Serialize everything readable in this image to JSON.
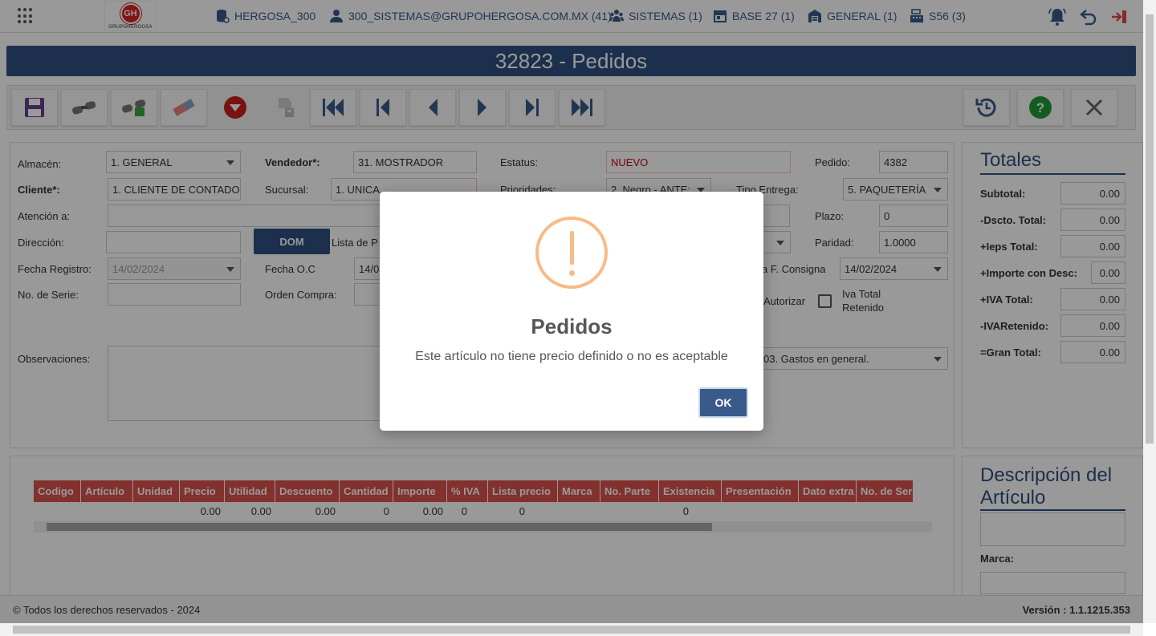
{
  "header": {
    "database": "HERGOSA_300",
    "user": "300_SISTEMAS@GRUPOHERGOSA.COM.MX (41)",
    "department": "SISTEMAS (1)",
    "base": "BASE 27 (1)",
    "warehouse": "GENERAL (1)",
    "terminal": "S56 (3)",
    "logo_initials": "GH",
    "logo_text": "GRUPOHERGOSA"
  },
  "page_title": "32823 - Pedidos",
  "toolbar": {
    "icons": [
      "save-icon",
      "binoculars-icon",
      "binoculars-green-icon",
      "eraser-icon",
      "down-circle-icon",
      "document-icon",
      "first-icon",
      "prev-page-icon",
      "prev-icon",
      "next-icon",
      "next-page-icon",
      "last-icon",
      "history-icon",
      "help-icon",
      "close-icon"
    ]
  },
  "form": {
    "almacen_label": "Almacén:",
    "almacen_value": "1. GENERAL",
    "vendedor_label": "Vendedor*:",
    "vendedor_value": "31. MOSTRADOR",
    "estatus_label": "Estatus:",
    "estatus_value": "NUEVO",
    "pedido_label": "Pedido:",
    "pedido_value": "4382",
    "cliente_label": "Cliente*:",
    "cliente_value": "1. CLIENTE DE CONTADO",
    "sucursal_label": "Sucursal:",
    "sucursal_value": "1. UNICA",
    "prioridades_label": "Prioridades:",
    "prioridades_value": "2. Negro - ANTE:",
    "tipo_entrega_label": "Tipo Entrega:",
    "tipo_entrega_value": "5. PAQUETERÍA",
    "atencion_label": "Atención a:",
    "plazo_label": "Plazo:",
    "plazo_value": "0",
    "direccion_label": "Dirección:",
    "dom_button": "DOM",
    "lista_label": "Lista de P",
    "paridad_label": "Paridad:",
    "paridad_value": "1.0000",
    "fecha_registro_label": "Fecha Registro:",
    "fecha_registro_value": "14/02/2024",
    "fecha_oc_label": "Fecha O.C",
    "fecha_oc_value": "14/0",
    "f_consigna_label": "a F. Consigna",
    "f_consigna_value": "14/02/2024",
    "serie_label": "No. de Serie:",
    "orden_label": "Orden Compra:",
    "autorizar_label": "Autorizar",
    "iva_retenido_label_1": "Iva Total",
    "iva_retenido_label_2": "Retenido",
    "observaciones_label": "Observaciones:",
    "uso_cfdi_value": "03. Gastos en general."
  },
  "totales": {
    "title": "Totales",
    "rows": [
      {
        "label": "Subtotal:",
        "value": "0.00"
      },
      {
        "label": "-Dscto. Total:",
        "value": "0.00"
      },
      {
        "label": "+Ieps Total:",
        "value": "0.00"
      },
      {
        "label": "+Importe con Desc:",
        "value": "0.00"
      },
      {
        "label": "+IVA Total:",
        "value": "0.00"
      },
      {
        "label": "-IVARetenido:",
        "value": "0.00"
      },
      {
        "label": "=Gran Total:",
        "value": "0.00"
      }
    ]
  },
  "grid": {
    "columns": [
      "Codigo",
      "Artículo",
      "Unidad",
      "Precio",
      "Utilidad",
      "Descuento",
      "Cantidad",
      "Importe",
      "% IVA",
      "Lista precio",
      "Marca",
      "No. Parte",
      "Existencia",
      "Presentación",
      "Dato extra",
      "No. de Seri"
    ],
    "row": [
      "",
      "",
      "",
      "0.00",
      "0.00",
      "0.00",
      "0",
      "0.00",
      "0",
      "0",
      "",
      "",
      "0",
      "",
      "",
      ""
    ]
  },
  "descripcion": {
    "title": "Descripción del Artículo",
    "marca_label": "Marca:"
  },
  "footer": {
    "copyright": "© Todos los derechos reservados - 2024",
    "version": "Versión : 1.1.1215.353"
  },
  "modal": {
    "title": "Pedidos",
    "message": "Este artículo no tiene precio definido o no es aceptable",
    "ok_label": "OK",
    "icon": "warning-icon",
    "icon_color": "#f8bb86"
  },
  "colors": {
    "primary": "#2f4f80",
    "grid_header": "#d9534f",
    "status_red": "#cc0000"
  }
}
